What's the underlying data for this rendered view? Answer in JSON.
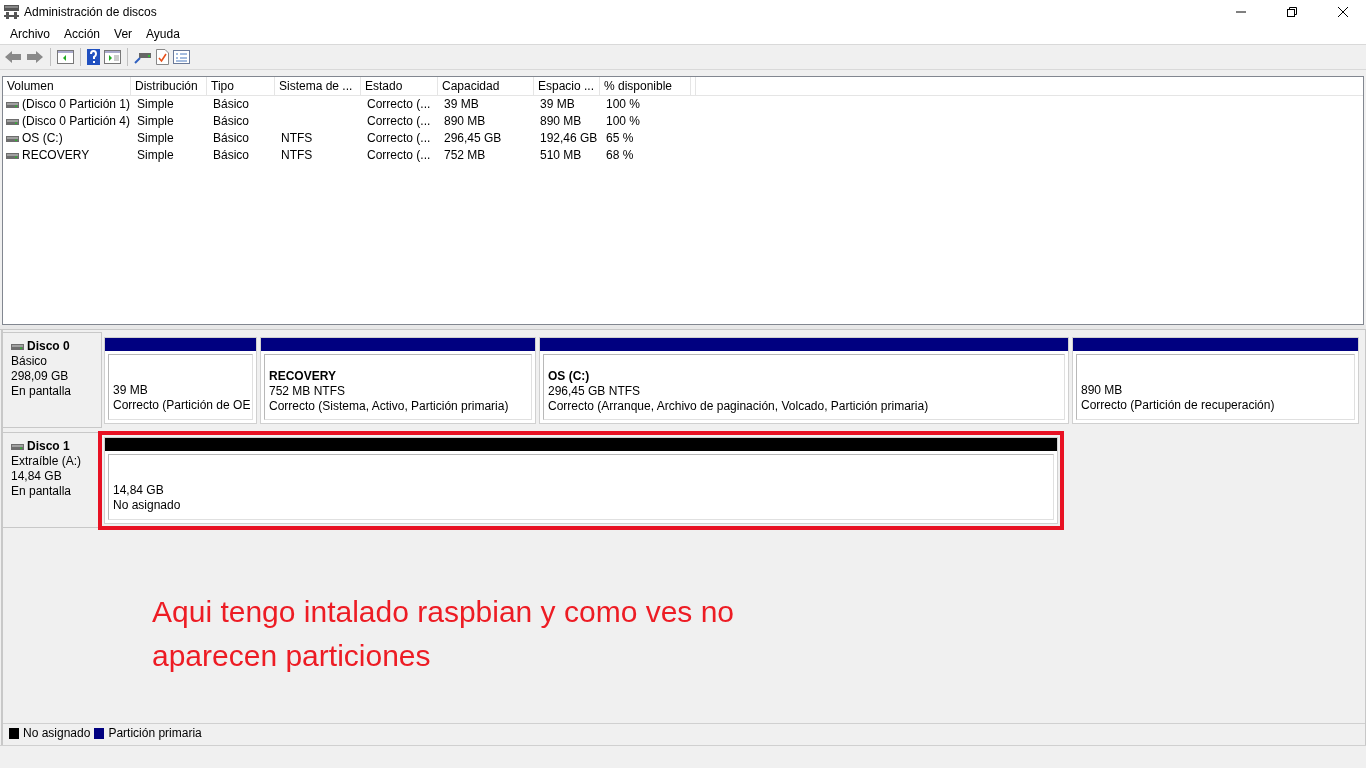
{
  "window": {
    "title": "Administración de discos"
  },
  "menu": [
    "Archivo",
    "Acción",
    "Ver",
    "Ayuda"
  ],
  "volume_table": {
    "columns": [
      "Volumen",
      "Distribución",
      "Tipo",
      "Sistema de ...",
      "Estado",
      "Capacidad",
      "Espacio ...",
      "% disponible"
    ],
    "rows": [
      {
        "cells": [
          "(Disco 0 Partición 1)",
          "Simple",
          "Básico",
          null,
          "Correcto (...",
          "39 MB",
          "39 MB",
          "100 %"
        ]
      },
      {
        "cells": [
          "(Disco 0 Partición 4)",
          "Simple",
          "Básico",
          null,
          "Correcto (...",
          "890 MB",
          "890 MB",
          "100 %"
        ]
      },
      {
        "cells": [
          "OS (C:)",
          "Simple",
          "Básico",
          "NTFS",
          "Correcto (...",
          "296,45 GB",
          "192,46 GB",
          "65 %"
        ]
      },
      {
        "cells": [
          "RECOVERY",
          "Simple",
          "Básico",
          "NTFS",
          "Correcto (...",
          "752 MB",
          "510 MB",
          "68 %"
        ]
      }
    ]
  },
  "disks": [
    {
      "name": "Disco 0",
      "type": "Básico",
      "size": "298,09 GB",
      "status": "En pantalla",
      "partitions": [
        {
          "color": "#000080",
          "size": "39 MB",
          "status": "Correcto (Partición de OE",
          "marked": false
        },
        {
          "color": "#000080",
          "name": "RECOVERY",
          "size": "752 MB NTFS",
          "status": "Correcto (Sistema, Activo, Partición primaria)",
          "marked": false
        },
        {
          "color": "#000080",
          "name": "OS  (C:)",
          "size": "296,45 GB NTFS",
          "status": "Correcto (Arranque, Archivo de paginación, Volcado, Partición primaria)",
          "marked": false
        },
        {
          "color": "#000080",
          "size": "890 MB",
          "status": "Correcto (Partición de recuperación)",
          "marked": false
        }
      ]
    },
    {
      "name": "Disco 1",
      "type": "Extraíble (A:)",
      "size": "14,84 GB",
      "status": "En pantalla",
      "partitions": [
        {
          "color": "#000000",
          "size": "14,84 GB",
          "status": "No asignado",
          "marked": true
        }
      ]
    }
  ],
  "annotation": "Aqui tengo intalado raspbian y como ves no aparecen particiones",
  "legend": [
    {
      "label": "No asignado",
      "color": "#000000"
    },
    {
      "label": "Partición primaria",
      "color": "#000080"
    }
  ]
}
